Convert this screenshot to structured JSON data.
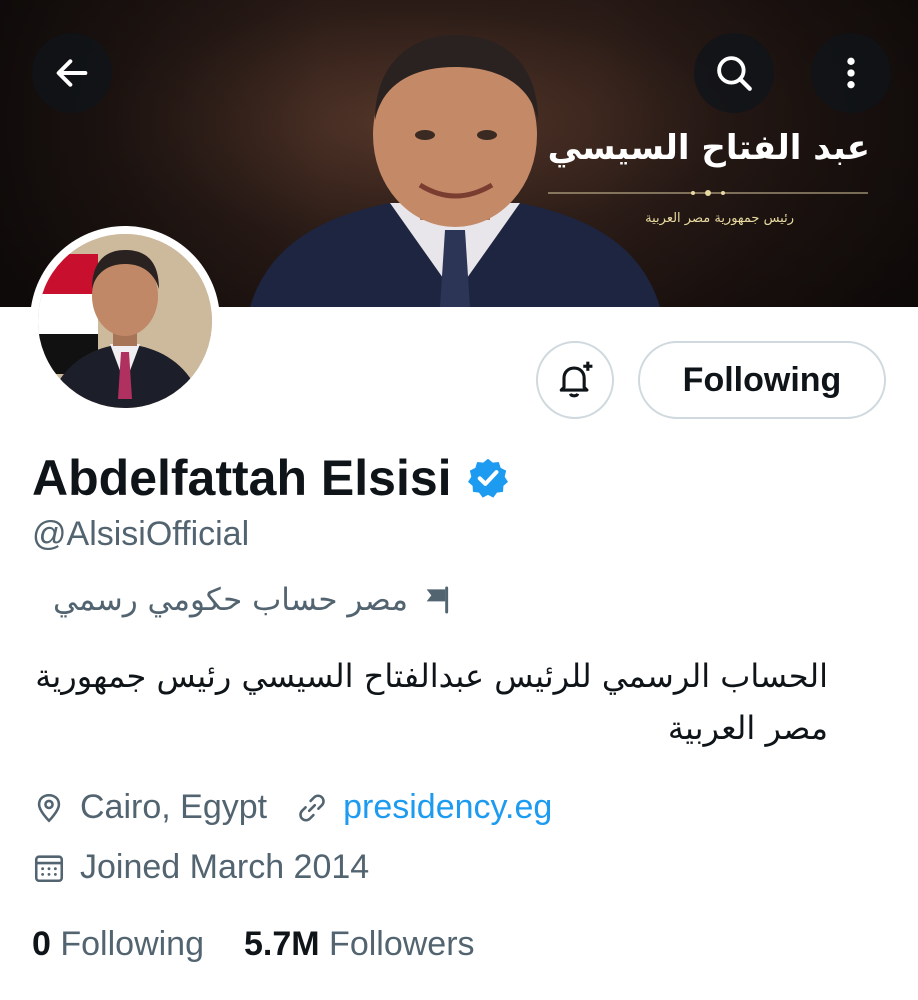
{
  "banner": {
    "name_arabic": "عبد الفتاح السيسي",
    "subtitle_arabic": "رئيس جمهورية مصر العربية"
  },
  "profile": {
    "display_name": "Abdelfattah Elsisi",
    "handle": "@AlsisiOfficial",
    "account_label": "مصر حساب حكومي رسمي",
    "bio": "الحساب الرسمي للرئيس عبدالفتاح السيسي رئيس جمهورية مصر العربية",
    "location": "Cairo, Egypt",
    "website": "presidency.eg",
    "joined": "Joined March 2014",
    "following_count": "0",
    "following_label": "Following",
    "followers_count": "5.7M",
    "followers_label": "Followers"
  },
  "actions": {
    "follow_state_label": "Following"
  },
  "icons": {
    "back": "arrow-left-icon",
    "search": "search-icon",
    "more": "more-vertical-icon",
    "notify": "bell-plus-icon",
    "verified": "verified-badge-icon",
    "flag": "flag-icon",
    "location": "location-pin-icon",
    "link": "link-icon",
    "calendar": "calendar-icon"
  },
  "colors": {
    "link": "#1d9bf0",
    "secondary_text": "#536471",
    "primary_text": "#0f1419",
    "verified": "#1d9bf0"
  }
}
